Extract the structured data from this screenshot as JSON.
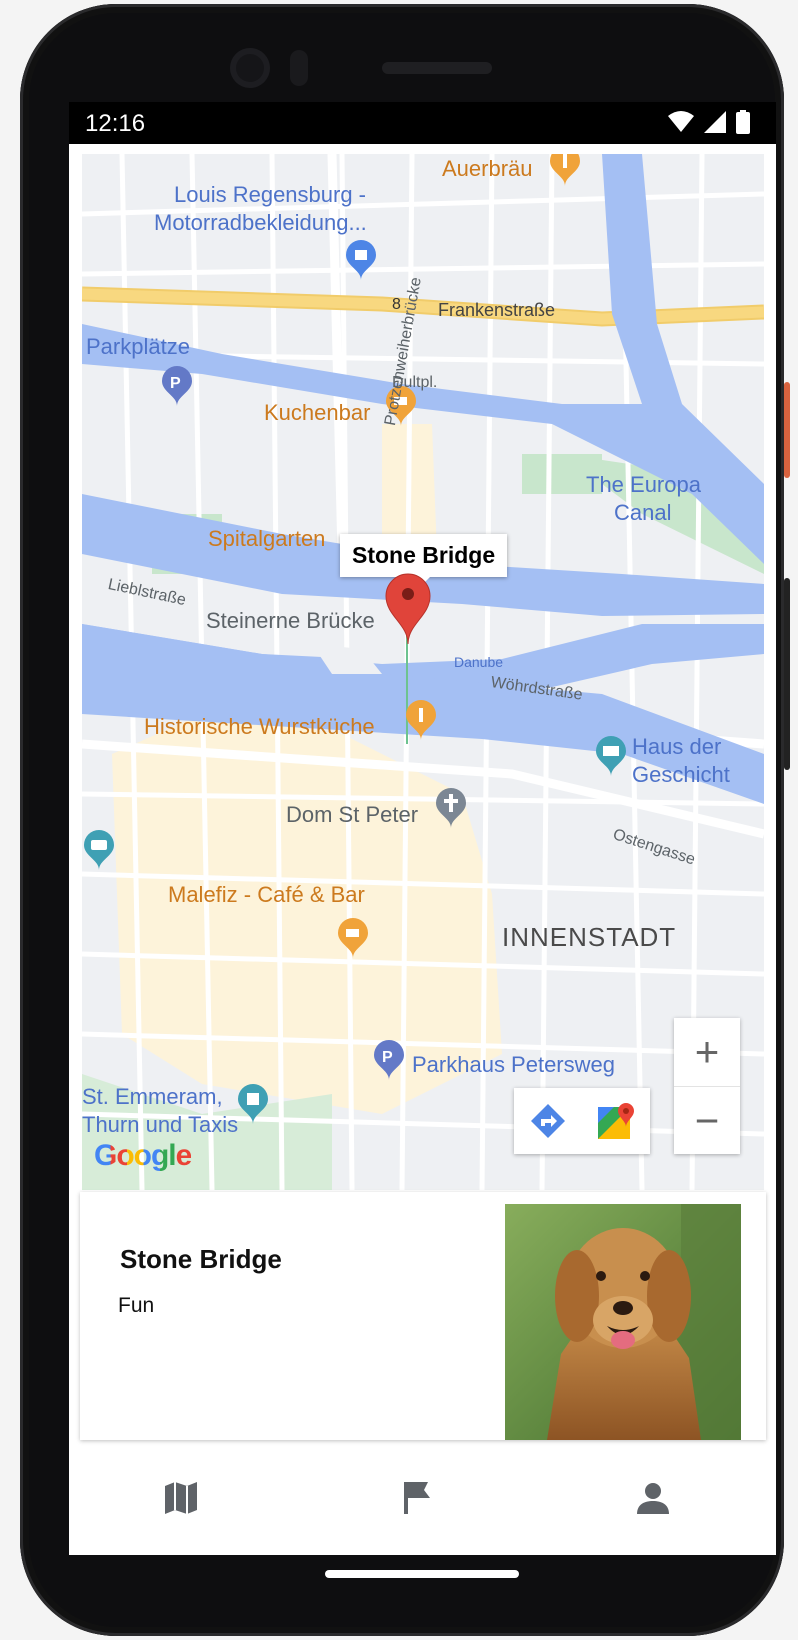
{
  "status": {
    "time": "12:16"
  },
  "map": {
    "labels": {
      "auerbrau": "Auerbräu",
      "louis1": "Louis Regensburg -",
      "louis2": "Motorradbekleidung...",
      "route8": "8",
      "frankenstrasse": "Frankenstraße",
      "parkplatze": "Parkplätze",
      "dultpl": "Dultpl.",
      "kuchenbar": "Kuchenbar",
      "protzen": "Protzenweiherbrücke",
      "europa1": "The Europa",
      "europa2": "Canal",
      "spitalgarten": "Spitalgarten",
      "lieblstrasse": "Lieblstraße",
      "steinerne": "Steinerne Brücke",
      "danube": "Danube",
      "wohrdstrasse": "Wöhrdstraße",
      "wurstkuche": "Historische Wurstküche",
      "hausder1": "Haus der",
      "hausder2": "Geschicht",
      "domstpeter": "Dom St Peter",
      "ostengasse": "Ostengasse",
      "malefiz": "Malefiz - Café & Bar",
      "innenstadt": "INNENSTADT",
      "parkhaus": "Parkhaus Petersweg",
      "emmeram1": "St. Emmeram,",
      "emmeram2": "Thurn und Taxis"
    },
    "tooltip": "Stone Bridge",
    "zoom_in": "+",
    "zoom_out": "−",
    "google_logo": "Google"
  },
  "card": {
    "title": "Stone Bridge",
    "subtitle": "Fun",
    "image": "golden-retriever-photo"
  },
  "nav": [
    "map-icon",
    "flag-icon",
    "person-icon"
  ],
  "colors": {
    "water": "#a4bff3",
    "park": "#c8e6cc",
    "main_road": "#f8d880",
    "accent_pin": "#e0443a"
  }
}
